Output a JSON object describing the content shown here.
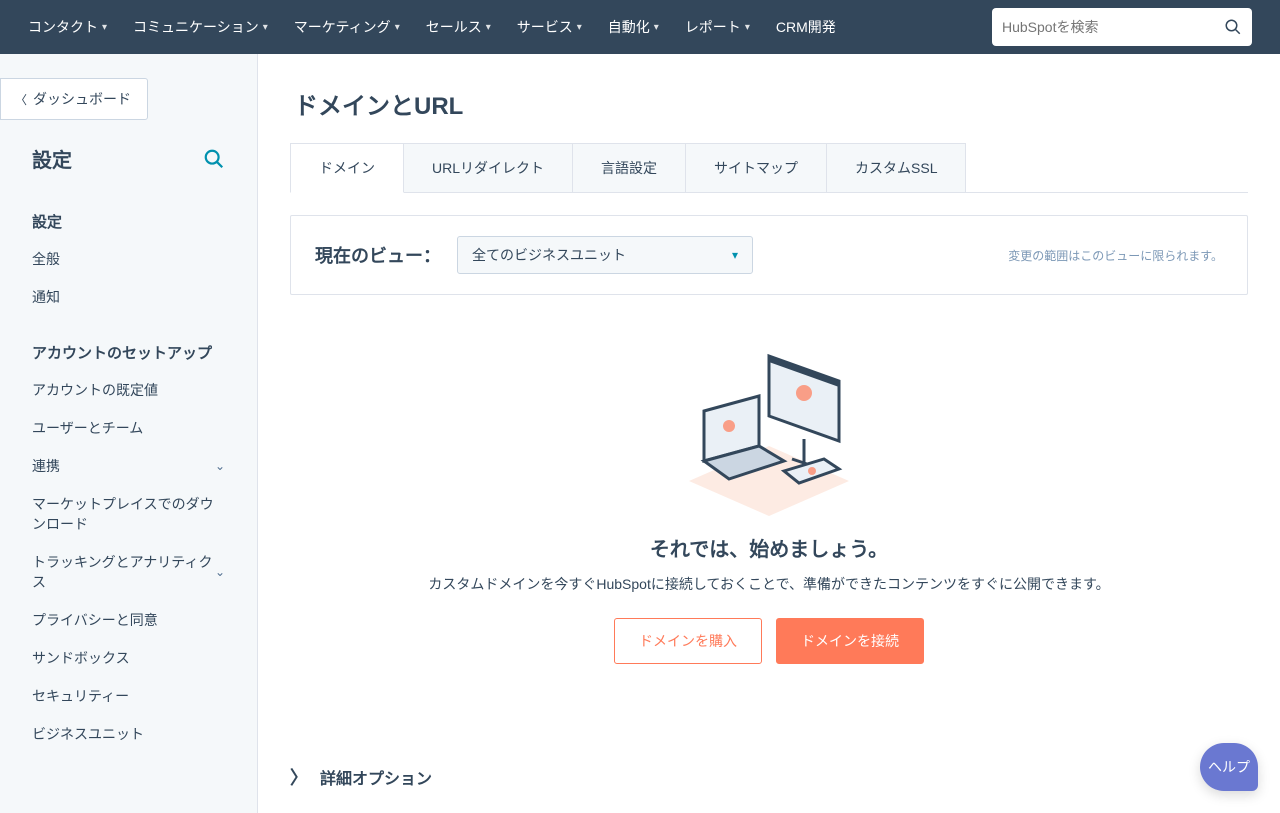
{
  "topnav": {
    "items": [
      "コンタクト",
      "コミュニケーション",
      "マーケティング",
      "セールス",
      "サービス",
      "自動化",
      "レポート"
    ],
    "crm": "CRM開発",
    "search_placeholder": "HubSpotを検索"
  },
  "sidebar": {
    "back": "ダッシュボード",
    "title": "設定",
    "section1_heading": "設定",
    "section1_items": [
      "全般",
      "通知"
    ],
    "section2_heading": "アカウントのセットアップ",
    "section2_items": [
      {
        "label": "アカウントの既定値",
        "chev": false
      },
      {
        "label": "ユーザーとチーム",
        "chev": false
      },
      {
        "label": "連携",
        "chev": true
      },
      {
        "label": "マーケットプレイスでのダウンロード",
        "chev": false
      },
      {
        "label": "トラッキングとアナリティクス",
        "chev": true
      },
      {
        "label": "プライバシーと同意",
        "chev": false
      },
      {
        "label": "サンドボックス",
        "chev": false
      },
      {
        "label": "セキュリティー",
        "chev": false
      },
      {
        "label": "ビジネスユニット",
        "chev": false
      }
    ]
  },
  "main": {
    "title": "ドメインとURL",
    "tabs": [
      "ドメイン",
      "URLリダイレクト",
      "言語設定",
      "サイトマップ",
      "カスタムSSL"
    ],
    "view_label": "現在のビュー：",
    "view_selected": "全てのビジネスユニット",
    "view_note": "変更の範囲はこのビューに限られます。",
    "empty_title": "それでは、始めましょう。",
    "empty_sub": "カスタムドメインを今すぐHubSpotに接続しておくことで、準備ができたコンテンツをすぐに公開できます。",
    "btn_buy": "ドメインを購入",
    "btn_connect": "ドメインを接続",
    "advanced": "詳細オプション"
  },
  "help": "ヘルプ"
}
